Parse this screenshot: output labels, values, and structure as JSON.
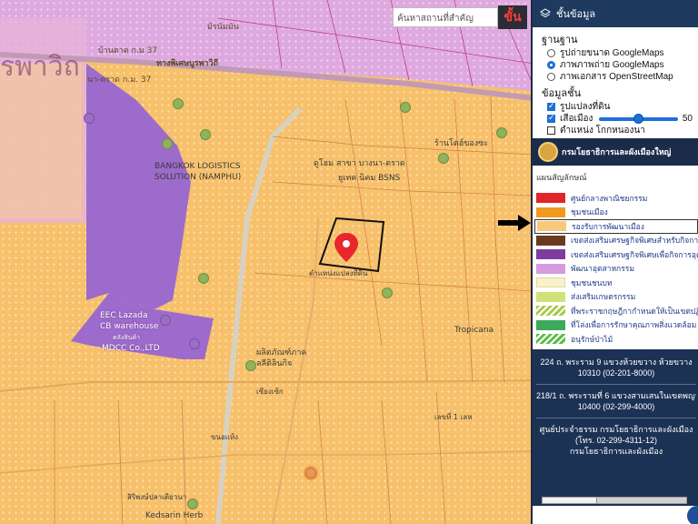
{
  "map": {
    "search_placeholder": "ค้นหาสถานที่สำคัญ",
    "search_button_label": "ขั้น",
    "labels": {
      "road_top": "บ้านตาด ก.ม 37",
      "road_top_2": "มัรนัมมัน",
      "road_top_3": "ทางพิเศษบูรพาวิถี",
      "road_top_4": "นา-ตราด ก.ม. 37",
      "left_big": "รพาวิถ",
      "bangkok_logistics": "BANGKOK LOGISTICS",
      "bangkok_logistics_2": "SOLUTION (NAMPHU)",
      "doohome": "ดูโฮม สาขา บางนา-ตราด",
      "doohome_2": "ยูเทค นิคม BSNS",
      "tiktok_label": "ร้านโตฮ์ของซะ",
      "lazada": "EEC Lazada",
      "lazada_2": "CB warehouse",
      "lazada_3": "คลังสินค้า",
      "mdcc": "MDCC Co.,LTD",
      "factory": "ผลิตภัณฑ์ภาค",
      "factory_2": "ลลีติลินกิจ",
      "kedsarin": "Kedsarin Herb",
      "tropicana": "Tropicana",
      "plot_label": "ตำแหน่งแปลงที่ดิน",
      "small_1": "ขนอแห้ง",
      "small_2": "เลขที่ 1 เลห",
      "small_3": "สิริพงษ์ปลาเตียวนา",
      "small_4": "เซียงเซ้ก"
    }
  },
  "panel": {
    "header": "ชั้นข้อมูล",
    "base_title": "ฐานฐาน",
    "base_options": [
      {
        "label": "รูปถ่ายขนาด GoogleMaps",
        "selected": false
      },
      {
        "label": "ภาพภาพถ่าย GoogleMaps",
        "selected": true
      },
      {
        "label": "ภาพเอกสาร OpenStreetMap",
        "selected": false
      }
    ],
    "layer_title": "ข้อมูลชั้น",
    "layer_options": [
      {
        "label": "รูปแปลงที่ดิน",
        "checked": true
      },
      {
        "label": "เสือเมือง",
        "checked": true,
        "slider_value": 50,
        "slider_label": "50"
      },
      {
        "label": "ตำแหน่ง โกกหนองนา",
        "checked": false
      }
    ],
    "org_name": "กรมโยธาธิการและผังเมืองใหญ่",
    "legend_title": "แผนสัญลักษณ์",
    "legend": [
      {
        "label": "ศูนย์กลางพาณิชยกรรม",
        "color": "#e0262b",
        "boxed": false
      },
      {
        "label": "ชุมชนเมือง",
        "color": "#f19a1f",
        "boxed": false
      },
      {
        "label": "รองรับการพัฒนาเมือง",
        "color": "#f7c97c",
        "boxed": true
      },
      {
        "label": "เขตส่งเสริมเศรษฐกิจพิเศษสำหรับกิจการพ",
        "color": "#6b3a1e",
        "boxed": false
      },
      {
        "label": "เขตส่งเสริมเศรษฐกิจพิเศษเพื่อกิจการอุตส",
        "color": "#7e3d9e",
        "boxed": false
      },
      {
        "label": "พัฒนาอุตสาหกรรม",
        "color": "#d79be0",
        "boxed": false
      },
      {
        "label": "ชุมชนชนบท",
        "color": "#f9f1c9",
        "boxed": false
      },
      {
        "label": "ส่งเสริมเกษตรกรรม",
        "color": "#cfe27a",
        "boxed": false
      },
      {
        "label": "ที่พระราชกฤษฎีกากำหนดให้เป็นเขตปฏิรูป",
        "color": "#a9c94a",
        "boxed": false,
        "hatched": true
      },
      {
        "label": "ที่โล่งเพื่อการรักษาคุณภาพสิ่งแวดล้อม",
        "color": "#3caa5a",
        "boxed": false
      },
      {
        "label": "อนุรักษ์ป่าไม้",
        "color": "#5bbd4a",
        "boxed": false,
        "hatched": true
      }
    ],
    "contact": {
      "line1": "224 ถ. พระราม 9 แขวงห้วยขวาง ห้วยขวาง",
      "line2": "10310 (02-201-8000)",
      "line3": "218/1 ถ. พระรามที่ 6 แขวงสามเสนในเขตพญาไท",
      "line4": "10400 (02-299-4000)",
      "line5": "ศูนย์ประจำธรรม กรมโยธาธิการและผังเมือง",
      "line6": "(โทร. 02-299-4311-12)",
      "line7": "กรมโยธาธิการและผังเมือง"
    }
  },
  "colors": {
    "zone_urban_support": "#f7c06b",
    "zone_industrial": "#d9a1e3",
    "zone_special": "#9a66c8",
    "panel_dark": "#1c3254",
    "pin": "#e8262b"
  }
}
